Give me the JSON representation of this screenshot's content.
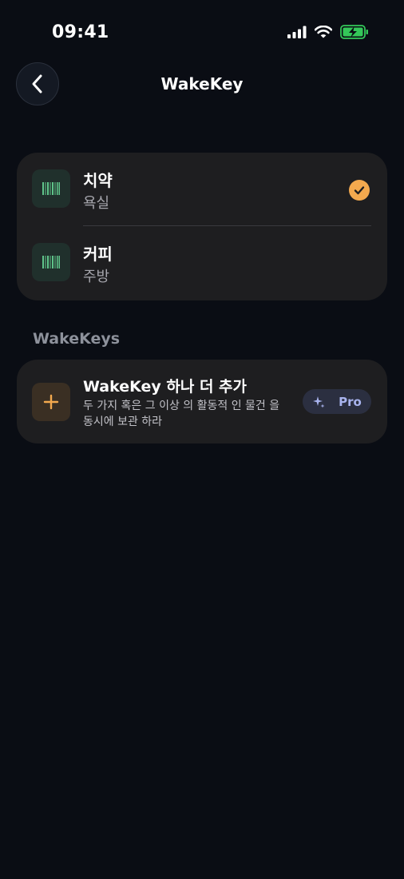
{
  "status_bar": {
    "time": "09:41"
  },
  "nav": {
    "title": "WakeKey",
    "back_icon": "chevron-left-icon"
  },
  "items": [
    {
      "title": "치약",
      "subtitle": "욕실",
      "icon": "barcode-icon",
      "selected": true
    },
    {
      "title": "커피",
      "subtitle": "주방",
      "icon": "barcode-icon",
      "selected": false
    }
  ],
  "section": {
    "label": "WakeKeys"
  },
  "add_card": {
    "title": "WakeKey 하나 더 추가",
    "description": "두 가지 혹은 그 이상 의 활동적 인 물건 을 동시에 보관 하라",
    "icon": "plus-icon",
    "pro_label": "Pro",
    "pro_icon": "sparkle-icon"
  },
  "colors": {
    "background": "#0a0d14",
    "card": "#1e1e20",
    "accent": "#f3a94e",
    "barcode": "#5fc48a",
    "pro_text": "#a9b4ee",
    "battery": "#34c759"
  }
}
